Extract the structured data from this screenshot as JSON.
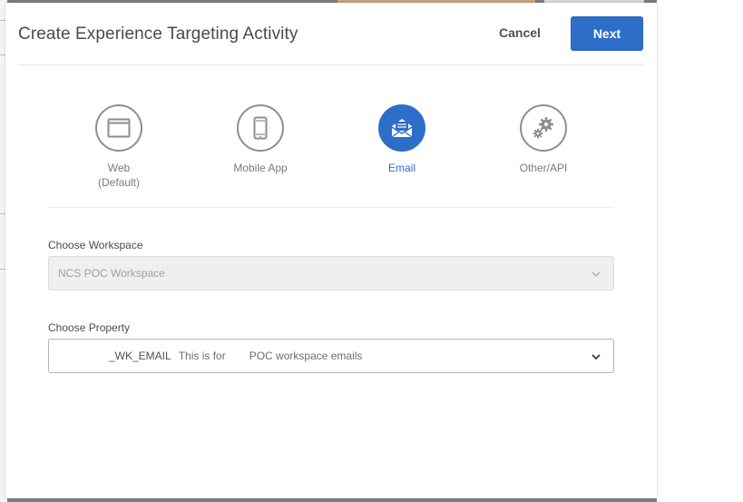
{
  "modal": {
    "title": "Create Experience Targeting Activity",
    "cancel_label": "Cancel",
    "next_label": "Next"
  },
  "channels": [
    {
      "label": "Web",
      "sub": "(Default)",
      "icon": "browser-window-icon",
      "selected": false
    },
    {
      "label": "Mobile App",
      "sub": "",
      "icon": "mobile-phone-icon",
      "selected": false
    },
    {
      "label": "Email",
      "sub": "",
      "icon": "envelope-icon",
      "selected": true
    },
    {
      "label": "Other/API",
      "sub": "",
      "icon": "gears-icon",
      "selected": false
    }
  ],
  "workspace": {
    "label": "Choose Workspace",
    "value": "NCS POC Workspace",
    "disabled": true
  },
  "property": {
    "label": "Choose Property",
    "value_name": "_WK_EMAIL",
    "value_desc_start": "This is for",
    "value_desc_end": "POC workspace emails"
  },
  "colors": {
    "accent": "#2d6ec8",
    "text": "#4b4b4b",
    "muted": "#7a7a7a",
    "disabled_bg": "#efefef"
  }
}
